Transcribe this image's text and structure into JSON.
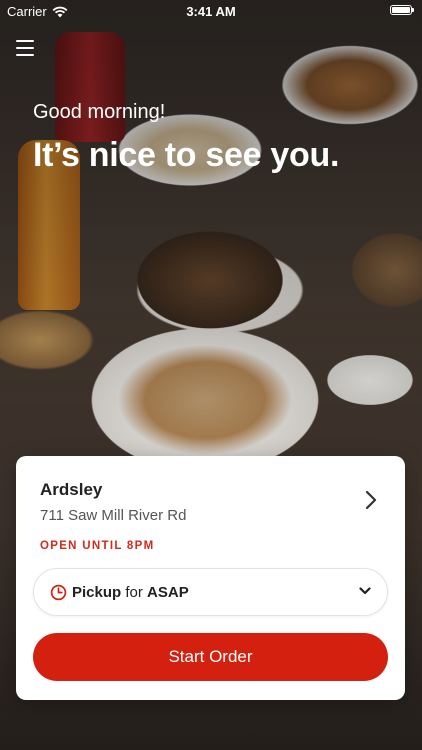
{
  "status_bar": {
    "carrier": "Carrier",
    "time": "3:41 AM"
  },
  "header": {
    "menu_icon": "hamburger-menu-icon"
  },
  "hero": {
    "greeting": "Good morning!",
    "headline": "It’s nice to see you."
  },
  "location_card": {
    "name": "Ardsley",
    "address": "711 Saw Mill River Rd",
    "hours": "OPEN UNTIL 8PM",
    "chevron_icon": "chevron-right-icon"
  },
  "order_type": {
    "icon": "clock-icon",
    "mode": "Pickup",
    "connector": "for",
    "time": "ASAP",
    "dropdown_icon": "chevron-down-icon"
  },
  "start_order": {
    "label": "Start Order"
  },
  "colors": {
    "accent": "#d4210f",
    "hours_text": "#d22a1d"
  }
}
